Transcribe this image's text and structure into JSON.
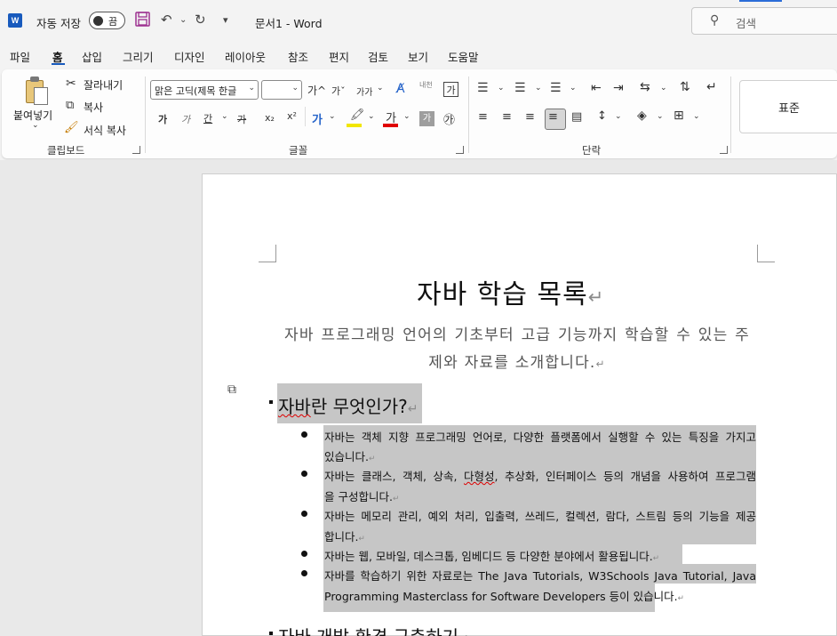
{
  "titlebar": {
    "app_icon": "word-icon",
    "app_icon_letter": "W",
    "autosave_label": "자동 저장",
    "autosave_state": "끔",
    "document_title": "문서1  -  Word",
    "search_placeholder": "검색"
  },
  "tabs": [
    {
      "label": "파일",
      "active": false
    },
    {
      "label": "홈",
      "active": true
    },
    {
      "label": "삽입",
      "active": false
    },
    {
      "label": "그리기",
      "active": false
    },
    {
      "label": "디자인",
      "active": false
    },
    {
      "label": "레이아웃",
      "active": false
    },
    {
      "label": "참조",
      "active": false
    },
    {
      "label": "편지",
      "active": false
    },
    {
      "label": "검토",
      "active": false
    },
    {
      "label": "보기",
      "active": false
    },
    {
      "label": "도움말",
      "active": false
    }
  ],
  "ribbon": {
    "clipboard": {
      "label": "클립보드",
      "paste": "붙여넣기",
      "cut": "잘라내기",
      "copy": "복사",
      "format_painter": "서식 복사"
    },
    "font": {
      "label": "글꼴",
      "font_name": "맑은 고딕(제목 한글",
      "font_size": "",
      "grow": "가^",
      "shrink": "가ˇ",
      "change_case": "가가",
      "bold": "가",
      "italic": "가",
      "underline": "간",
      "strike": "가",
      "subscript": "x₂",
      "superscript": "x²",
      "text_effects": "가",
      "font_color": "가",
      "char_shading": "가",
      "enclose": "㉮",
      "phonetic": "내천",
      "char_border": "가",
      "highlight_color": "#f2e600",
      "font_color_value": "#e00000"
    },
    "paragraph": {
      "label": "단락"
    },
    "styles": {
      "normal": "표준"
    }
  },
  "document": {
    "title": "자바 학습 목록",
    "subtitle": "자바 프로그래밍 언어의 기초부터 고급 기능까지 학습할 수 있는 주제와 자료를 소개합니다.",
    "section1_heading_pre": "자바",
    "section1_heading_post": "란 무엇인가?",
    "bullets": [
      {
        "lines": [
          "자바는 객체 지향 프로그래밍 언어로, 다양한 플랫폼에서 실행할 수 있는 특징을 가지고",
          "있습니다."
        ]
      },
      {
        "lines": [
          "자바는 클래스, 객체, 상속, ",
          "다형성",
          ", 추상화, 인터페이스 등의 개념을 사용하여 프로그램",
          "을 구성합니다."
        ]
      },
      {
        "lines": [
          "자바는 메모리 관리, 예외 처리, 입출력, 쓰레드, 컬렉션, 람다, 스트림 등의 기능을 제공",
          "합니다."
        ]
      },
      {
        "lines": [
          "자바는 웹, 모바일, 데스크톱, 임베디드 등 다양한 분야에서 활용됩니다."
        ]
      },
      {
        "lines": [
          "자바를 학습하기 위한 자료로는 The Java Tutorials, W3Schools Java Tutorial, Java",
          "Programming Masterclass for Software Developers 등이 있습니다."
        ]
      }
    ],
    "section2_heading": "자바 개발 환경 구축하기",
    "para_mark": "↵"
  }
}
